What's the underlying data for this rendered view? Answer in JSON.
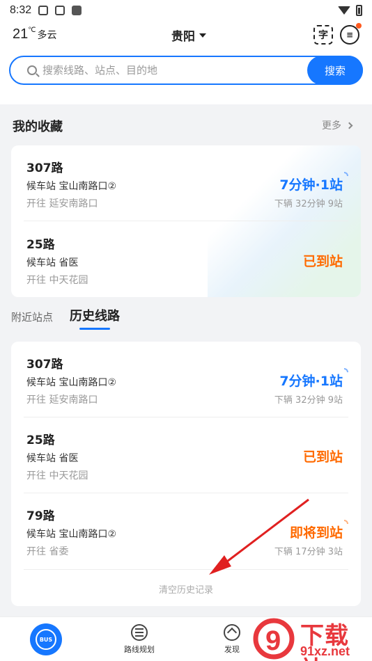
{
  "status_bar": {
    "time": "8:32"
  },
  "header": {
    "temperature": "21",
    "temperature_unit": "℃",
    "weather": "多云",
    "city": "贵阳",
    "scan_icon_glyph": "字"
  },
  "search": {
    "placeholder": "搜索线路、站点、目的地",
    "button_label": "搜索"
  },
  "favorites": {
    "title": "我的收藏",
    "more_label": "更多",
    "routes": [
      {
        "line": "307路",
        "stop": "候车站 宝山南路口②",
        "direction": "开往 延安南路口",
        "eta": "7分钟·1站",
        "eta_color": "#1677ff",
        "next": "下辆  32分钟 9站"
      },
      {
        "line": "25路",
        "stop": "候车站 省医",
        "direction": "开往 中天花园",
        "eta": "已到站",
        "eta_color": "#ff6a00",
        "next": ""
      }
    ]
  },
  "tabs": {
    "nearby": "附近站点",
    "history": "历史线路"
  },
  "history": {
    "routes": [
      {
        "line": "307路",
        "stop": "候车站 宝山南路口②",
        "direction": "开往 延安南路口",
        "eta": "7分钟·1站",
        "eta_color": "#1677ff",
        "next": "下辆  32分钟 9站"
      },
      {
        "line": "25路",
        "stop": "候车站 省医",
        "direction": "开往 中天花园",
        "eta": "已到站",
        "eta_color": "#ff6a00",
        "next": ""
      },
      {
        "line": "79路",
        "stop": "候车站 宝山南路口②",
        "direction": "开往 省委",
        "eta": "即将到站",
        "eta_color": "#ff6a00",
        "next": "下辆  17分钟 3站"
      }
    ],
    "clear_label": "清空历史记录"
  },
  "bottom_nav": {
    "bus_label": "BUS",
    "route_plan": "路线规划",
    "discover": "发现"
  },
  "watermark": {
    "text": "下载站",
    "url": "91xz.net",
    "logo_text": "9"
  },
  "colors": {
    "accent": "#1677ff",
    "arrival": "#ff6a00",
    "annotation_arrow": "#e02020"
  }
}
